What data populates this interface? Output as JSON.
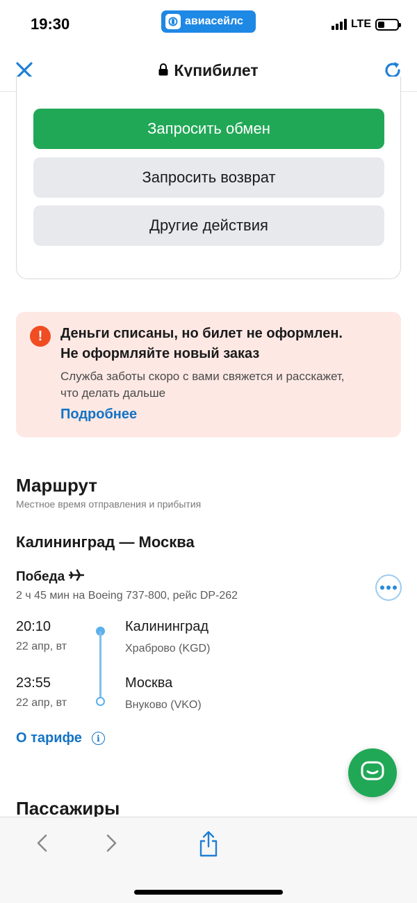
{
  "status_bar": {
    "time": "19:30",
    "app_label": "авиасейлс",
    "network": "LTE",
    "battery_level": 0.35
  },
  "nav": {
    "title": "Купибилет",
    "close_icon": "close-icon",
    "reload_icon": "reload-icon"
  },
  "actions": {
    "exchange_label": "Запросить обмен",
    "refund_label": "Запросить возврат",
    "other_label": "Другие действия"
  },
  "alert": {
    "title_line1": "Деньги списаны, но билет не оформлен.",
    "title_line2": "Не оформляйте новый заказ",
    "body_line1": "Служба заботы скоро с вами свяжется и расскажет,",
    "body_line2": "что делать дальше",
    "link": "Подробнее",
    "color": "#f04d22"
  },
  "route": {
    "heading": "Маршрут",
    "subheading": "Местное время отправления и прибытия",
    "cities": "Калининград — Москва",
    "airline": "Победа",
    "details": "2 ч 45 мин на Boeing 737-800, рейс DP-262",
    "departure": {
      "time": "20:10",
      "date": "22 апр, вт",
      "city": "Калининград",
      "airport": "Храброво (KGD)"
    },
    "arrival": {
      "time": "23:55",
      "date": "22 апр, вт",
      "city": "Москва",
      "airport": "Внуково (VKO)"
    },
    "tariff_link": "О тарифе"
  },
  "passengers": {
    "heading": "Пассажиры"
  },
  "colors": {
    "primary_green": "#21a857",
    "link_blue": "#1473c4",
    "alert_bg": "#fde8e4"
  }
}
